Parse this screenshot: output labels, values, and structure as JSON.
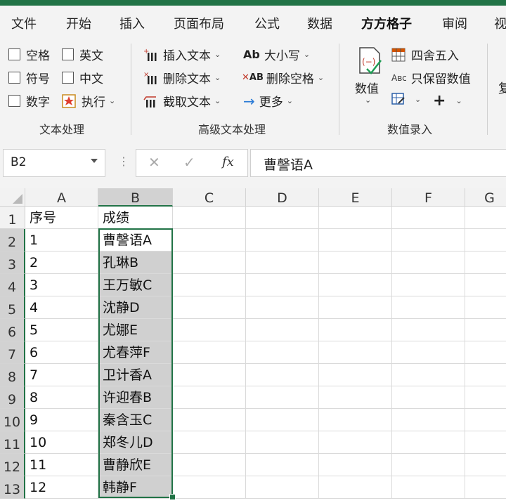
{
  "menu": {
    "tabs": [
      "文件",
      "开始",
      "插入",
      "页面布局",
      "公式",
      "数据",
      "方方格子",
      "审阅",
      "视"
    ],
    "active": "方方格子"
  },
  "ribbon": {
    "text_group": {
      "label": "文本处理",
      "checks": [
        "空格",
        "英文",
        "符号",
        "中文",
        "数字"
      ],
      "execute": "执行"
    },
    "adv_group": {
      "label": "高级文本处理",
      "insert_text": "插入文本",
      "delete_text": "删除文本",
      "extract_text": "截取文本",
      "case": "大小写",
      "delete_space": "删除空格",
      "more": "更多"
    },
    "num_group": {
      "label": "数值录入",
      "value": "数值",
      "round": "四舍五入",
      "keep_num": "只保留数值",
      "overflow": "复"
    }
  },
  "formula_bar": {
    "name_box": "B2",
    "content": "曹謦语A"
  },
  "columns": [
    "A",
    "B",
    "C",
    "D",
    "E",
    "F",
    "G"
  ],
  "rows": [
    {
      "n": "1",
      "a": "序号",
      "b": "成绩"
    },
    {
      "n": "2",
      "a": "1",
      "b": "曹謦语A"
    },
    {
      "n": "3",
      "a": "2",
      "b": "孔琳B"
    },
    {
      "n": "4",
      "a": "3",
      "b": "王万敏C"
    },
    {
      "n": "5",
      "a": "4",
      "b": "沈静D"
    },
    {
      "n": "6",
      "a": "5",
      "b": "尤娜E"
    },
    {
      "n": "7",
      "a": "6",
      "b": "尤春萍F"
    },
    {
      "n": "8",
      "a": "7",
      "b": "卫计香A"
    },
    {
      "n": "9",
      "a": "8",
      "b": "许迎春B"
    },
    {
      "n": "10",
      "a": "9",
      "b": "秦含玉C"
    },
    {
      "n": "11",
      "a": "10",
      "b": "郑冬儿D"
    },
    {
      "n": "12",
      "a": "11",
      "b": "曹静欣E"
    },
    {
      "n": "13",
      "a": "12",
      "b": "韩静F"
    }
  ],
  "colors": {
    "accent": "#217346",
    "selection": "#d0d0d0",
    "insert_icon_red": "#c0392b",
    "arrow_blue": "#2b7bd6"
  }
}
